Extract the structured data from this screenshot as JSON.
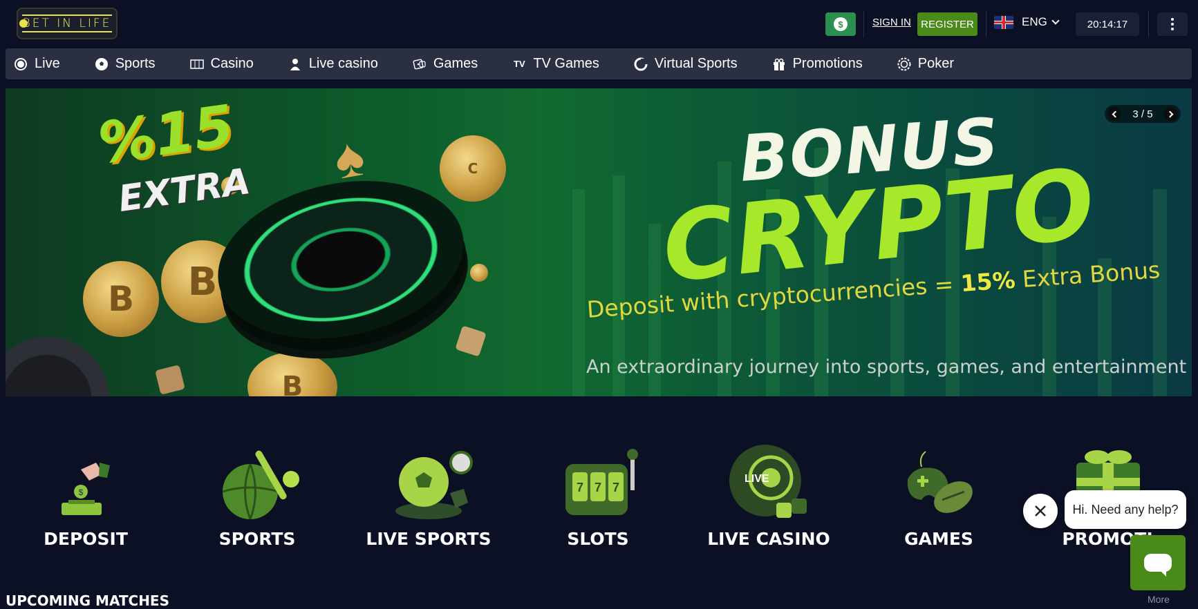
{
  "header": {
    "logo_text": "BET IN LIFE",
    "currency_icon": "dollar-coin-icon",
    "sign_in": "SIGN IN",
    "register": "REGISTER",
    "language": "ENG",
    "clock": "20:14:17"
  },
  "nav": {
    "items": [
      {
        "label": "Live",
        "icon": "live-dot-icon"
      },
      {
        "label": "Sports",
        "icon": "soccer-ball-icon"
      },
      {
        "label": "Casino",
        "icon": "slot-machine-icon"
      },
      {
        "label": "Live casino",
        "icon": "dealer-icon"
      },
      {
        "label": "Games",
        "icon": "dice-icon"
      },
      {
        "label": "TV Games",
        "icon": "tv-icon"
      },
      {
        "label": "Virtual Sports",
        "icon": "virtual-icon"
      },
      {
        "label": "Promotions",
        "icon": "gift-icon"
      },
      {
        "label": "Poker",
        "icon": "poker-chip-icon"
      }
    ]
  },
  "banner": {
    "promo_pct": "%15",
    "promo_extra": "EXTRA",
    "bonus": "BONUS",
    "crypto": "CRYPTO",
    "deposit_line_a": "Deposit with cryptocurrencies = ",
    "deposit_line_b": "15%",
    "deposit_line_c": " Extra Bonus",
    "tagline": "An extraordinary journey into sports, games, and entertainment",
    "slide_indicator": "3 / 5"
  },
  "categories": [
    {
      "label": "DEPOSIT",
      "icon": "deposit-icon"
    },
    {
      "label": "SPORTS",
      "icon": "sports-icon"
    },
    {
      "label": "LIVE SPORTS",
      "icon": "live-sports-icon"
    },
    {
      "label": "SLOTS",
      "icon": "slots-icon"
    },
    {
      "label": "LIVE CASINO",
      "icon": "live-casino-icon"
    },
    {
      "label": "GAMES",
      "icon": "games-icon"
    },
    {
      "label": "PROMOTI",
      "icon": "promotions-gift-icon"
    }
  ],
  "upcoming": {
    "title": "UPCOMING MATCHES",
    "more": "More"
  },
  "help": {
    "message": "Hi. Need any help?"
  },
  "colors": {
    "background": "#0b1024",
    "nav": "#2a3042",
    "accent_green": "#4a8a19",
    "currency_green": "#2c8f52",
    "lime": "#a8e82a"
  }
}
